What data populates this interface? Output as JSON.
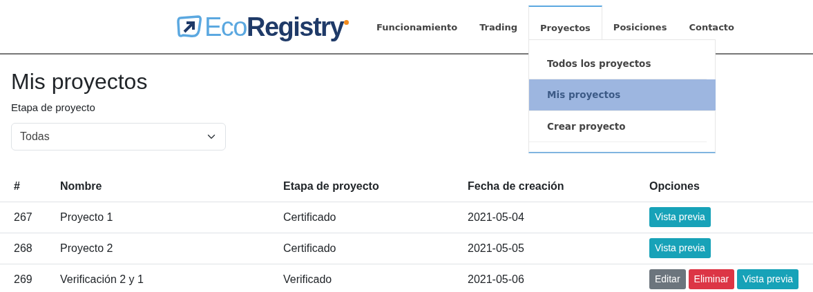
{
  "logo": {
    "text": "Eco**Registry**"
  },
  "nav": [
    {
      "label": "Funcionamiento",
      "selected": false
    },
    {
      "label": "Trading",
      "selected": false
    },
    {
      "label": "Proyectos",
      "selected": true,
      "expanded": true,
      "menu": [
        {
          "label": "Todos los proyectos",
          "selected": false
        },
        {
          "label": "Mis proyectos",
          "selected": true
        },
        {
          "label": "Crear proyecto",
          "selected": false
        }
      ]
    },
    {
      "label": "Posiciones",
      "selected": false
    },
    {
      "label": "Contacto",
      "selected": false
    }
  ],
  "page_title": "Mis proyectos",
  "filter": {
    "label": "Etapa de proyecto",
    "value": "Todas"
  },
  "table": {
    "columns": [
      "#",
      "Nombre",
      "Etapa de proyecto",
      "Fecha de creación",
      "Opciones"
    ],
    "rows": [
      {
        "id": "267",
        "name": "Proyecto 1",
        "stage": "Certificado",
        "date": "2021-05-04",
        "actions": [
          {
            "label": "Vista previa",
            "kind": "preview"
          }
        ]
      },
      {
        "id": "268",
        "name": "Proyecto 2",
        "stage": "Certificado",
        "date": "2021-05-05",
        "actions": [
          {
            "label": "Vista previa",
            "kind": "preview"
          }
        ]
      },
      {
        "id": "269",
        "name": "Verificación 2 y 1",
        "stage": "Verificado",
        "date": "2021-05-06",
        "actions": [
          {
            "label": "Editar",
            "kind": "edit"
          },
          {
            "label": "Eliminar",
            "kind": "delete"
          },
          {
            "label": "Vista previa",
            "kind": "preview"
          }
        ]
      }
    ]
  }
}
